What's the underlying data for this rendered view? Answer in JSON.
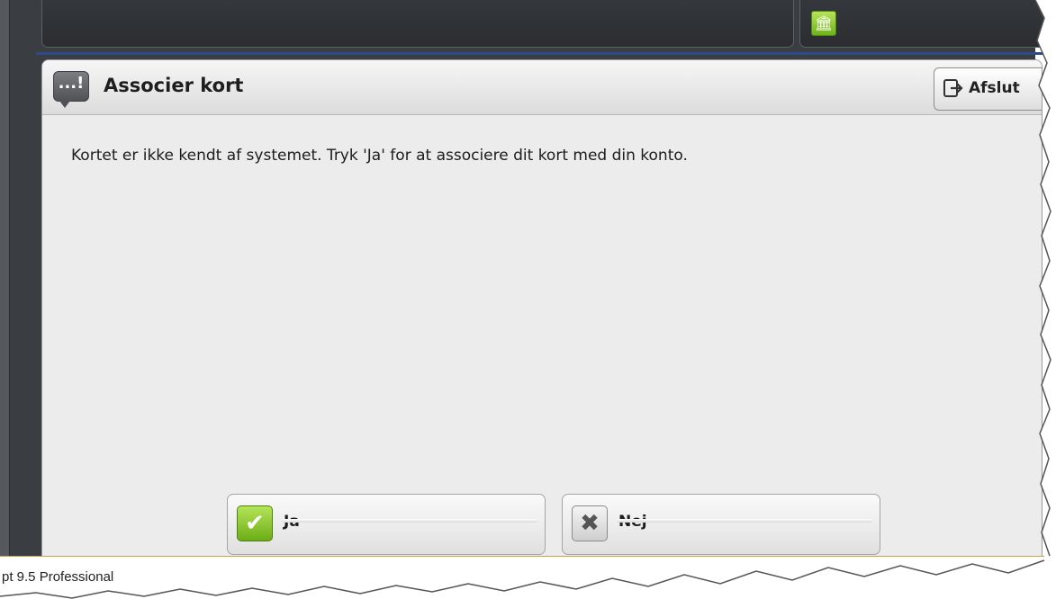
{
  "top_bar": {
    "clipped_text": ""
  },
  "dialog": {
    "title": "Associer kort",
    "alert_icon_glyph": "...!",
    "exit_label": "Afslut",
    "message": "Kortet er ikke kendt af systemet. Tryk 'Ja' for at associere dit kort med din konto.",
    "yes_label": "Ja",
    "no_label": "Nej"
  },
  "status_bar": {
    "text": "pt 9.5 Professional"
  },
  "icons": [
    "bank-icon",
    "alert-icon",
    "exit-icon",
    "check-icon",
    "x-icon"
  ],
  "colors": {
    "frame": "#3a3d42",
    "accent_green": "#7cc22a",
    "dialog_bg": "#ececec",
    "blue_line": "#2d4b8a"
  }
}
